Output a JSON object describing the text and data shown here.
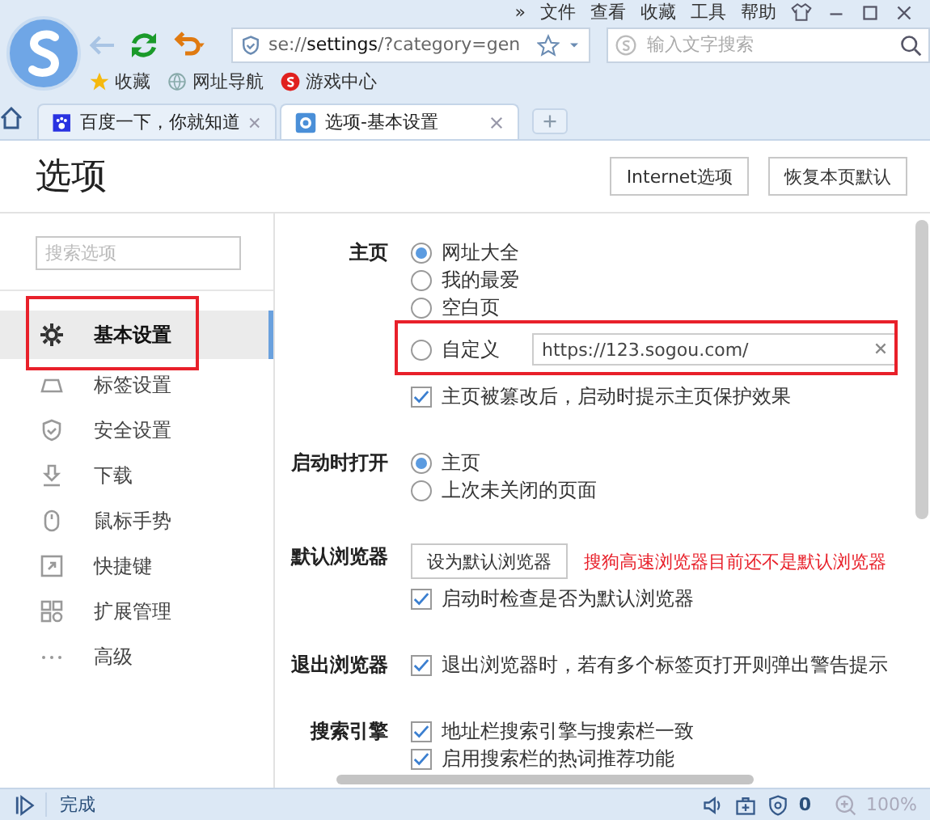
{
  "menu_bar": {
    "overflow": "»",
    "items": [
      "文件",
      "查看",
      "收藏",
      "工具",
      "帮助"
    ]
  },
  "toolbar": {
    "address": "se://**settings**/?category=gen",
    "search_placeholder": "输入文字搜索"
  },
  "bookmarks": [
    {
      "label": "收藏",
      "kind": "star"
    },
    {
      "label": "网址导航",
      "kind": "globe"
    },
    {
      "label": "游戏中心",
      "kind": "game"
    }
  ],
  "tabs": [
    {
      "label": "百度一下，你就知道",
      "selected": false
    },
    {
      "label": "选项-基本设置",
      "selected": true
    }
  ],
  "page": {
    "title": "选项",
    "buttons": [
      "Internet选项",
      "恢复本页默认"
    ]
  },
  "sidebar": {
    "search_placeholder": "搜索选项",
    "items": [
      {
        "label": "基本设置",
        "selected": true,
        "highlighted": true
      },
      {
        "label": "标签设置",
        "selected": false,
        "highlighted": false
      },
      {
        "label": "安全设置",
        "selected": false,
        "highlighted": false
      },
      {
        "label": "下载",
        "selected": false,
        "highlighted": false
      },
      {
        "label": "鼠标手势",
        "selected": false,
        "highlighted": false
      },
      {
        "label": "快捷键",
        "selected": false,
        "highlighted": false
      },
      {
        "label": "扩展管理",
        "selected": false,
        "highlighted": false
      },
      {
        "label": "高级",
        "selected": false,
        "highlighted": false
      }
    ]
  },
  "sections": [
    {
      "label": "主页",
      "items": [
        {
          "kind": "radio",
          "label": "网址大全",
          "selected": true
        },
        {
          "kind": "radio",
          "label": "我的最爱",
          "selected": false
        },
        {
          "kind": "radio",
          "label": "空白页",
          "selected": false
        },
        {
          "kind": "radio",
          "label": "自定义",
          "selected": false,
          "value": "https://123.sogou.com/",
          "highlighted": true
        },
        {
          "kind": "checkbox",
          "label": "主页被篡改后，启动时提示主页保护效果",
          "checked": true
        }
      ]
    },
    {
      "label": "启动时打开",
      "items": [
        {
          "kind": "radio",
          "label": "主页",
          "selected": true
        },
        {
          "kind": "radio",
          "label": "上次未关闭的页面",
          "selected": false
        }
      ]
    },
    {
      "label": "默认浏览器",
      "items": [
        {
          "kind": "button",
          "label": "设为默认浏览器",
          "note": "搜狗高速浏览器目前还不是默认浏览器"
        },
        {
          "kind": "checkbox",
          "label": "启动时检查是否为默认浏览器",
          "checked": true
        }
      ]
    },
    {
      "label": "退出浏览器",
      "items": [
        {
          "kind": "checkbox",
          "label": "退出浏览器时，若有多个标签页打开则弹出警告提示",
          "checked": true
        }
      ]
    },
    {
      "label": "搜索引擎",
      "items": [
        {
          "kind": "checkbox",
          "label": "地址栏搜索引擎与搜索栏一致",
          "checked": true
        },
        {
          "kind": "checkbox",
          "label": "启用搜索栏的热词推荐功能",
          "checked": true
        }
      ]
    }
  ],
  "status_bar": {
    "text": "完成",
    "blocked_count": "0",
    "zoom": "100%"
  }
}
